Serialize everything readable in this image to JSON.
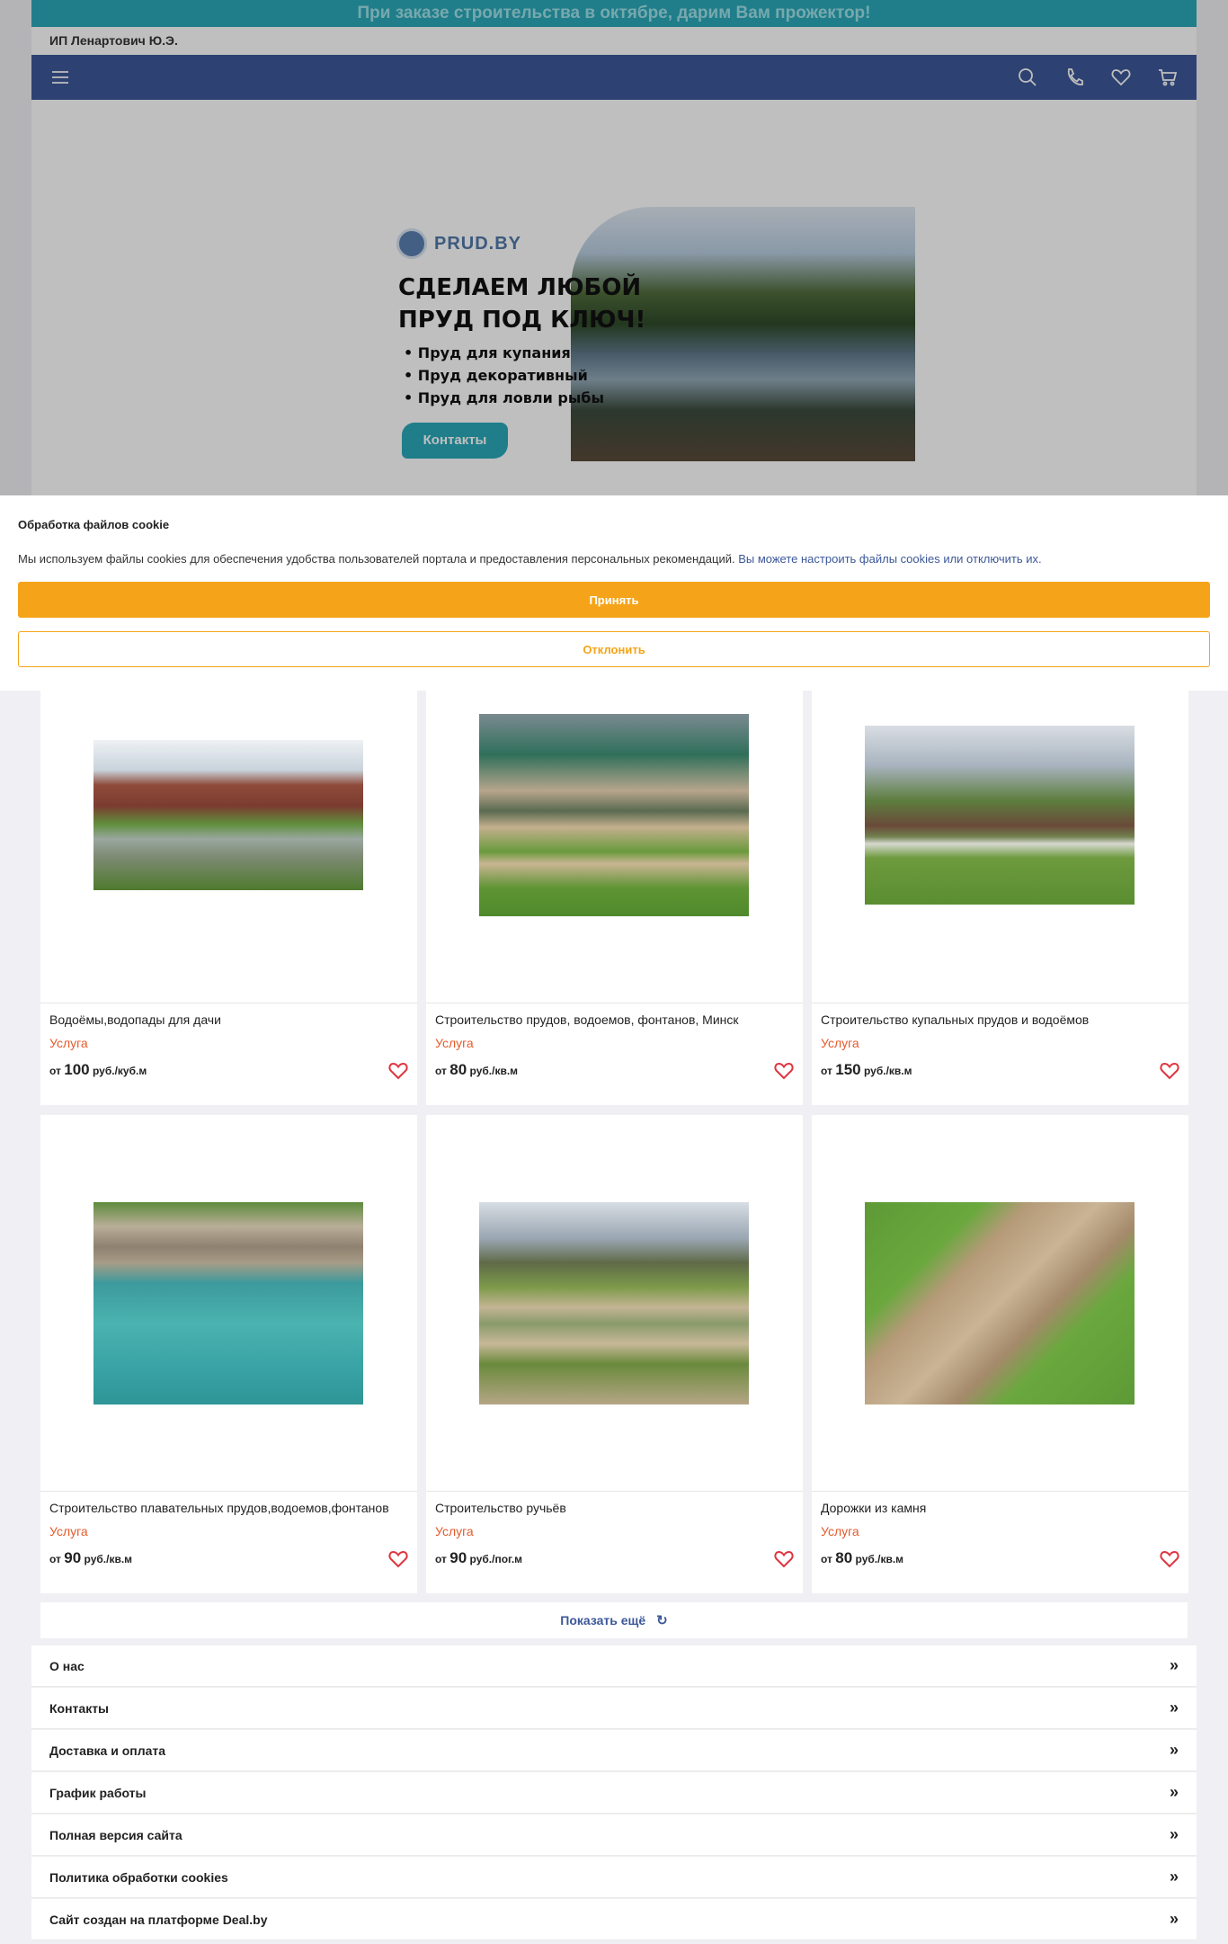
{
  "promo": {
    "text": "При заказе строительства в октябре, дарим Вам прожектор!"
  },
  "seller": {
    "name": "ИП Ленартович Ю.Э."
  },
  "header": {
    "menu_icon": "hamburger-menu-icon",
    "search_icon": "search-icon",
    "phone_icon": "phone-icon",
    "favorites_icon": "heart-icon",
    "cart_icon": "cart-icon",
    "colors": {
      "navbar": "#3c5899",
      "promo": "#2aa8b8"
    }
  },
  "banner": {
    "logo": "PRUD.BY",
    "headline_line1": "СДЕЛАЕМ ЛЮБОЙ",
    "headline_line2": "ПРУД ПОД КЛЮЧ!",
    "bullets": [
      "• Пруд для купания",
      "• Пруд декоративный",
      "• Пруд для ловли рыбы"
    ],
    "cta": "Контакты"
  },
  "cookie": {
    "title": "Обработка файлов cookie",
    "text": "Мы используем файлы cookies для обеспечения удобства пользователей портала и предоставления персональных рекомендаций.",
    "link": "Вы можете настроить файлы cookies или отключить их.",
    "accept_label": "Принять",
    "decline_label": "Отклонить",
    "colors": {
      "accept": "#f5a419"
    }
  },
  "products": [
    {
      "title": "Водоёмы,водопады для дачи",
      "type": "Услуга",
      "price_prefix": "от",
      "price": "100",
      "unit": "руб./куб.м"
    },
    {
      "title": "Строительство прудов, водоемов, фонтанов, Минск",
      "type": "Услуга",
      "price_prefix": "от",
      "price": "80",
      "unit": "руб./кв.м"
    },
    {
      "title": "Строительство купальных прудов и водоёмов",
      "type": "Услуга",
      "price_prefix": "от",
      "price": "150",
      "unit": "руб./кв.м"
    },
    {
      "title": "Строительство плавательных прудов,водоемов,фонтанов",
      "type": "Услуга",
      "price_prefix": "от",
      "price": "90",
      "unit": "руб./кв.м"
    },
    {
      "title": "Строительство ручьёв",
      "type": "Услуга",
      "price_prefix": "от",
      "price": "90",
      "unit": "руб./пог.м"
    },
    {
      "title": "Дорожки из камня",
      "type": "Услуга",
      "price_prefix": "от",
      "price": "80",
      "unit": "руб./кв.м"
    }
  ],
  "show_more": {
    "label": "Показать ещё",
    "icon": "refresh-icon"
  },
  "footer_links": [
    "О нас",
    "Контакты",
    "Доставка и оплата",
    "График работы",
    "Полная версия сайта",
    "Политика обработки cookies",
    "Сайт создан на платформе Deal.by"
  ]
}
